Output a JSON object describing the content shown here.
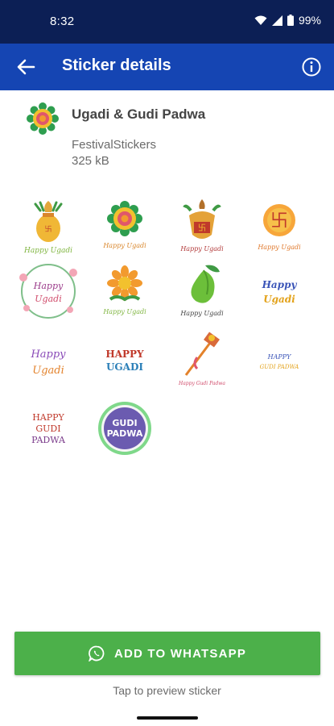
{
  "status": {
    "time": "8:32",
    "battery": "99%"
  },
  "app_bar": {
    "title": "Sticker details"
  },
  "pack": {
    "name": "Ugadi & Gudi Padwa",
    "publisher": "FestivalStickers",
    "size": "325 kB"
  },
  "stickers": [
    {
      "caption": "Happy Ugadi"
    },
    {
      "caption": "Happy Ugadi"
    },
    {
      "caption": "Happy Ugadi"
    },
    {
      "caption": "Happy Ugadi"
    },
    {
      "line1": "Happy",
      "line2": "Ugadi"
    },
    {
      "caption": "Happy Ugadi"
    },
    {
      "caption": "Happy Ugadi"
    },
    {
      "line1": "Happy",
      "line2": "Ugadi"
    },
    {
      "line1": "Happy",
      "line2": "Ugadi"
    },
    {
      "line1": "HAPPY",
      "line2": "UGADI"
    },
    {
      "caption": "Happy Gudi Padwa"
    },
    {
      "line1": "HAPPY",
      "line2": "GUDI PADWA"
    },
    {
      "line1": "HAPPY",
      "line2": "GUDI",
      "line3": "PADWA"
    },
    {
      "line1": "GUDI",
      "line2": "PADWA"
    }
  ],
  "actions": {
    "add_label": "ADD TO WHATSAPP",
    "hint": "Tap to preview sticker"
  },
  "colors": {
    "status_bar": "#0c1f55",
    "app_bar": "#1545b3",
    "add_button": "#4cb04a"
  }
}
